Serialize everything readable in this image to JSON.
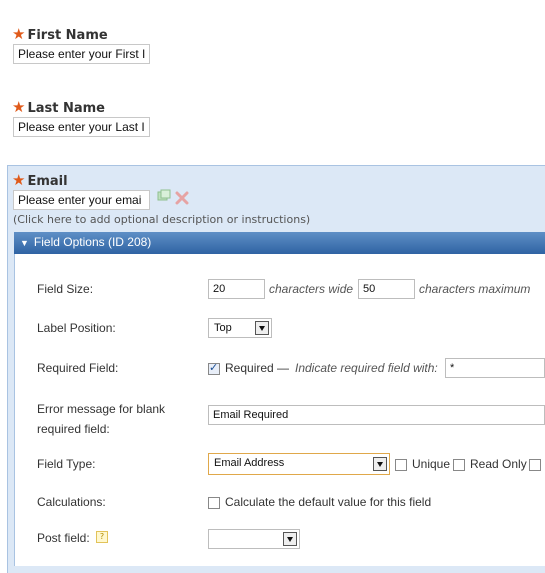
{
  "fields": {
    "first_name": {
      "label": "First Name",
      "placeholder": "Please enter your First I"
    },
    "last_name": {
      "label": "Last Name",
      "placeholder": "Please enter your Last I"
    },
    "email": {
      "label": "Email",
      "placeholder": "Please enter your emai",
      "description_hint": "(Click here to add optional description or instructions)"
    }
  },
  "field_options": {
    "title": "Field Options (ID 208)",
    "field_size": {
      "label": "Field Size:",
      "width_value": "20",
      "width_text": "characters wide",
      "max_value": "50",
      "max_text": "characters maximum"
    },
    "label_position": {
      "label": "Label Position:",
      "value": "Top"
    },
    "required_field": {
      "label": "Required Field:",
      "checkbox_label": "Required —",
      "indicator_text": "Indicate required field with:",
      "indicator_value": "*",
      "checked": true
    },
    "error_message": {
      "label_line1": "Error message for blank",
      "label_line2": "required field:",
      "value": "Email Required"
    },
    "field_type": {
      "label": "Field Type:",
      "value": "Email Address",
      "unique_label": "Unique",
      "read_only_label": "Read Only"
    },
    "calculations": {
      "label": "Calculations:",
      "checkbox_label": "Calculate the default value for this field"
    },
    "post_field": {
      "label": "Post field:",
      "value": ""
    }
  },
  "colors": {
    "required_star": "#e05a1a",
    "options_bar": "#2f63a3",
    "selected_bg": "#dce8f6"
  }
}
